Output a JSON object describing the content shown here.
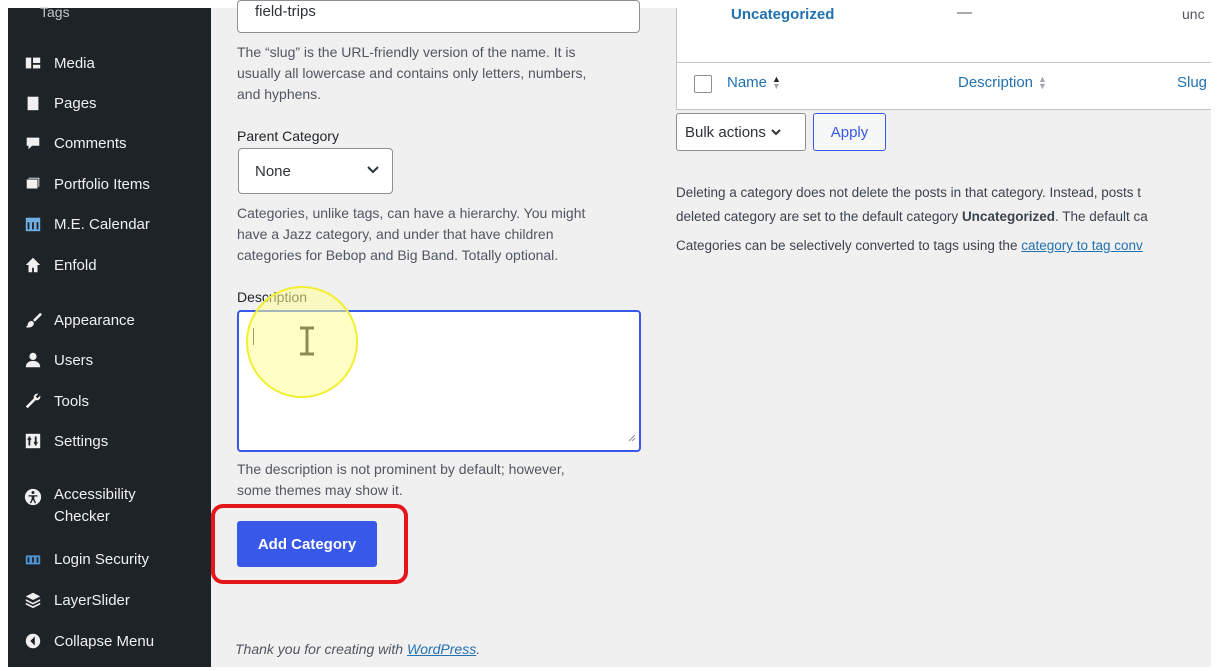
{
  "sidebar": {
    "tags_label": "Tags",
    "items": [
      {
        "label": "Media",
        "icon": "media-icon"
      },
      {
        "label": "Pages",
        "icon": "pages-icon"
      },
      {
        "label": "Comments",
        "icon": "comments-icon"
      },
      {
        "label": "Portfolio Items",
        "icon": "portfolio-icon"
      },
      {
        "label": "M.E. Calendar",
        "icon": "calendar-icon"
      },
      {
        "label": "Enfold",
        "icon": "home-icon"
      },
      {
        "label": "Appearance",
        "icon": "paintbrush-icon"
      },
      {
        "label": "Users",
        "icon": "users-icon"
      },
      {
        "label": "Tools",
        "icon": "wrench-icon"
      },
      {
        "label": "Settings",
        "icon": "settings-icon"
      },
      {
        "label": "Accessibility",
        "label2": "Checker",
        "icon": "accessibility-icon"
      },
      {
        "label": "Login Security",
        "icon": "security-icon"
      },
      {
        "label": "LayerSlider",
        "icon": "layers-icon"
      },
      {
        "label": "Collapse Menu",
        "icon": "collapse-icon"
      }
    ]
  },
  "form": {
    "slug_value": "field-trips",
    "slug_help": [
      "The “slug” is the URL-friendly version of the name. It is",
      "usually all lowercase and contains only letters, numbers,",
      "and hyphens."
    ],
    "parent_label": "Parent Category",
    "parent_value": "None",
    "parent_help": [
      "Categories, unlike tags, can have a hierarchy. You might",
      "have a Jazz category, and under that have children",
      "categories for Bebop and Big Band. Totally optional."
    ],
    "description_label": "Description",
    "description_value": "",
    "description_help": [
      "The description is not prominent by default; however,",
      "some themes may show it."
    ],
    "add_button": "Add Category"
  },
  "footer": {
    "text": "Thank you for creating with ",
    "link": "WordPress",
    "end": "."
  },
  "table": {
    "row_name": "Uncategorized",
    "row_description": "—",
    "row_slug": "unc",
    "columns": {
      "name": "Name",
      "description": "Description",
      "slug": "Slug"
    }
  },
  "bulk": {
    "label": "Bulk actions",
    "apply": "Apply"
  },
  "notes": {
    "line1": "Deleting a category does not delete the posts in that category. Instead, posts t",
    "line2_pre": "deleted category are set to the default category ",
    "line2_bold": "Uncategorized",
    "line2_post": ". The default ca",
    "line3_pre": "Categories can be selectively converted to tags using the ",
    "line3_link": "category to tag conv"
  }
}
